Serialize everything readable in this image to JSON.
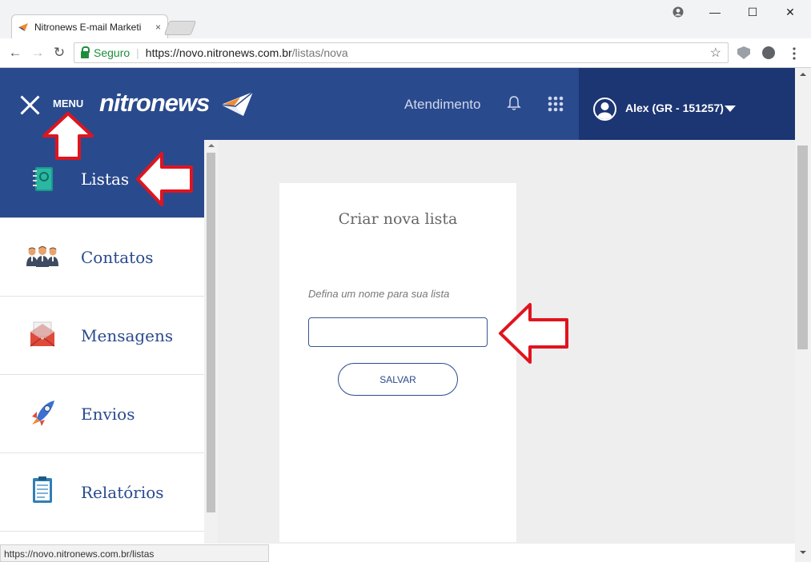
{
  "browser": {
    "tab_title": "Nitronews E-mail Marketi",
    "tab_close": "×",
    "window_controls": {
      "minimize": "—",
      "maximize": "☐",
      "close": "✕"
    },
    "nav": {
      "back": "←",
      "forward": "→",
      "reload": "↻"
    },
    "address": {
      "secure_label": "Seguro",
      "separator": "|",
      "url_host": "https://novo.nitronews.com.br",
      "url_path": "/listas/nova"
    },
    "star": "☆",
    "status_url": "https://novo.nitronews.com.br/listas"
  },
  "header": {
    "menu_label": "MENU",
    "logo_text": "nitronews",
    "support_link": "Atendimento",
    "user_name": "Alex (GR - 151257)"
  },
  "sidebar": {
    "items": [
      {
        "label": "Listas",
        "icon": "notebook-icon",
        "active": true
      },
      {
        "label": "Contatos",
        "icon": "people-icon",
        "active": false
      },
      {
        "label": "Mensagens",
        "icon": "envelope-icon",
        "active": false
      },
      {
        "label": "Envios",
        "icon": "rocket-icon",
        "active": false
      },
      {
        "label": "Relatórios",
        "icon": "clipboard-icon",
        "active": false
      }
    ]
  },
  "form": {
    "title": "Criar nova lista",
    "field_label": "Defina um nome para sua lista",
    "field_value": "",
    "save_label": "SALVAR"
  },
  "colors": {
    "primary": "#2a4a8e",
    "header_dark": "#1c3573",
    "annotation_arrow": "#e0141e"
  }
}
